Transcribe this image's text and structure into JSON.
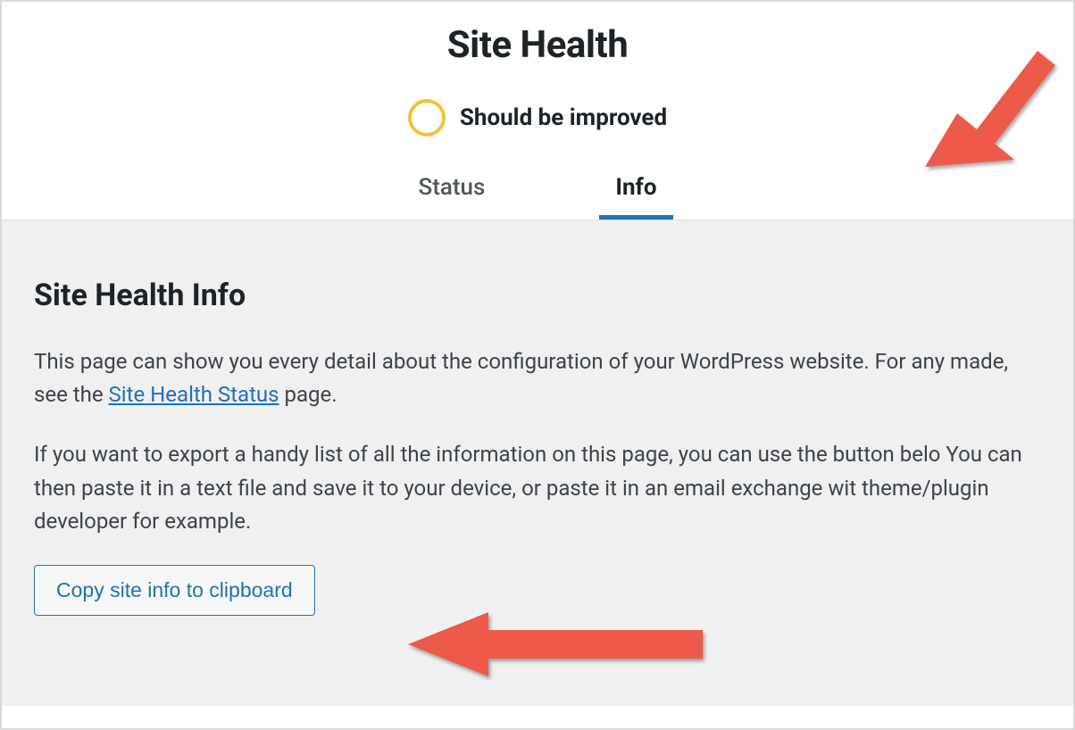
{
  "header": {
    "title": "Site Health",
    "status_label": "Should be improved"
  },
  "tabs": [
    {
      "label": "Status",
      "active": false
    },
    {
      "label": "Info",
      "active": true
    }
  ],
  "section": {
    "title": "Site Health Info",
    "para1_pre": "This page can show you every detail about the configuration of your WordPress website. For any made, see the ",
    "para1_link": "Site Health Status",
    "para1_post": " page.",
    "para2": "If you want to export a handy list of all the information on this page, you can use the button belo You can then paste it in a text file and save it to your device, or paste it in an email exchange wit theme/plugin developer for example.",
    "copy_button": "Copy site info to clipboard"
  }
}
